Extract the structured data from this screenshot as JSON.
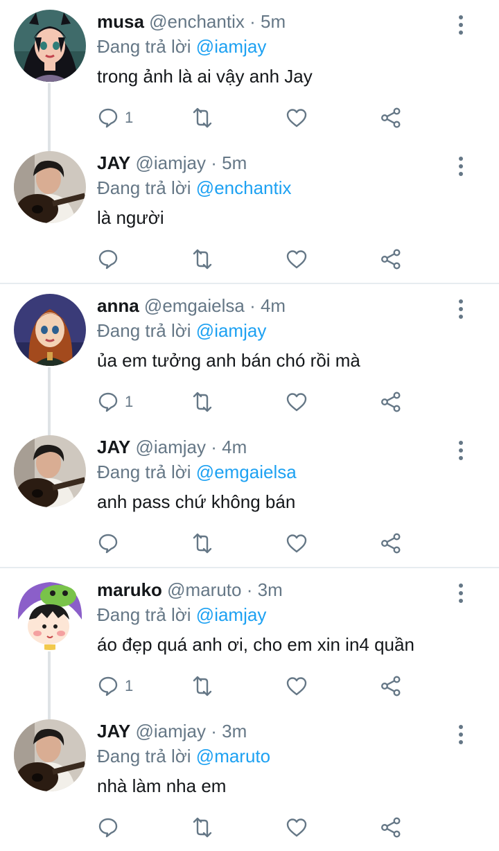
{
  "colors": {
    "name": "#14171a",
    "muted": "#657786",
    "mention": "#1da1f2",
    "thread_line": "#dfe3e6",
    "divider": "#e6ecf0"
  },
  "threads": [
    {
      "reply": {
        "name": "musa",
        "handle": "@enchantix",
        "time": "5m",
        "replying_prefix": "Đang trả lời",
        "mention": "@iamjay",
        "text": "trong ảnh là ai vậy anh Jay",
        "reply_count": "1",
        "avatar": "avatar-musa"
      },
      "answer": {
        "name": "JAY",
        "handle": "@iamjay",
        "time": "5m",
        "replying_prefix": "Đang trả lời",
        "mention": "@enchantix",
        "text": "là người",
        "avatar": "avatar-jay"
      }
    },
    {
      "reply": {
        "name": "anna",
        "handle": "@emgaielsa",
        "time": "4m",
        "replying_prefix": "Đang trả lời",
        "mention": "@iamjay",
        "text": "ủa em tưởng anh bán chó rồi mà",
        "reply_count": "1",
        "avatar": "avatar-anna"
      },
      "answer": {
        "name": "JAY",
        "handle": "@iamjay",
        "time": "4m",
        "replying_prefix": "Đang trả lời",
        "mention": "@emgaielsa",
        "text": "anh pass chứ không bán",
        "avatar": "avatar-jay"
      }
    },
    {
      "reply": {
        "name": "maruko",
        "handle": "@maruto",
        "time": "3m",
        "replying_prefix": "Đang trả lời",
        "mention": "@iamjay",
        "text": "áo đẹp quá anh ơi, cho em xin in4 quần",
        "reply_count": "1",
        "avatar": "avatar-maruko"
      },
      "answer": {
        "name": "JAY",
        "handle": "@iamjay",
        "time": "3m",
        "replying_prefix": "Đang trả lời",
        "mention": "@maruto",
        "text": "nhà làm nha em",
        "avatar": "avatar-jay"
      }
    }
  ],
  "icons": {
    "reply": "comment-icon",
    "retweet": "retweet-icon",
    "like": "heart-icon",
    "share": "share-icon",
    "more": "more-vertical-icon"
  }
}
